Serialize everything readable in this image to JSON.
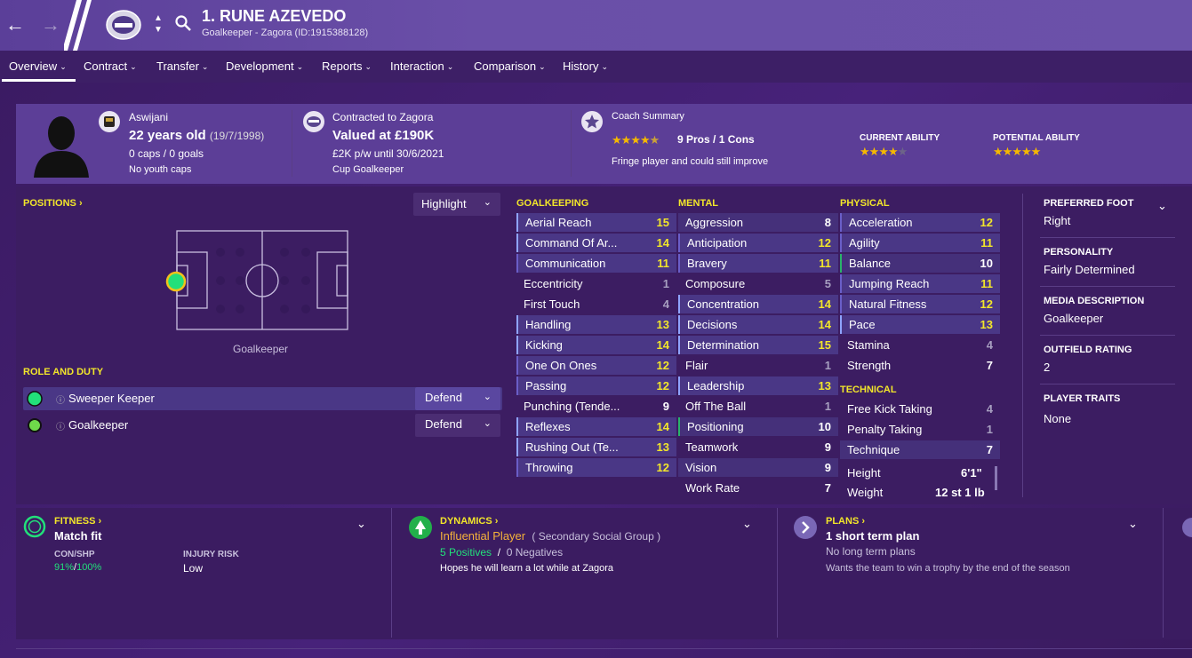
{
  "header": {
    "player_title": "1. RUNE AZEVEDO",
    "subtitle": "Goalkeeper - Zagora (ID:1915388128)"
  },
  "nav": {
    "tabs": [
      "Overview",
      "Contract",
      "Transfer",
      "Development",
      "Reports",
      "Interaction",
      "Comparison",
      "History"
    ]
  },
  "profile": {
    "nationality": "Aswijani",
    "age_label": "22 years old",
    "dob": "(19/7/1998)",
    "caps": "0 caps / 0 goals",
    "youth_caps": "No youth caps",
    "contracted": "Contracted to Zagora",
    "valued": "Valued at £190K",
    "wage": "£2K p/w until 30/6/2021",
    "role_status": "Cup Goalkeeper",
    "coach_summary_title": "Coach Summary",
    "pros_cons": "9 Pros / 1 Cons",
    "coach_note": "Fringe player and could still improve",
    "current_ability_label": "CURRENT ABILITY",
    "potential_ability_label": "POTENTIAL ABILITY",
    "coach_stars": 4.5,
    "current_stars": 4,
    "potential_stars": 5
  },
  "positions": {
    "title": "POSITIONS",
    "highlight": "Highlight",
    "position_label": "Goalkeeper",
    "role_duty_title": "ROLE AND DUTY",
    "roles": [
      {
        "name": "Sweeper Keeper",
        "duty": "Defend"
      },
      {
        "name": "Goalkeeper",
        "duty": "Defend"
      }
    ]
  },
  "attributes": {
    "goalkeeping_title": "GOALKEEPING",
    "mental_title": "MENTAL",
    "physical_title": "PHYSICAL",
    "technical_title": "TECHNICAL",
    "goalkeeping": [
      {
        "name": "Aerial Reach",
        "value": "15"
      },
      {
        "name": "Command Of Ar...",
        "value": "14"
      },
      {
        "name": "Communication",
        "value": "11"
      },
      {
        "name": "Eccentricity",
        "value": "1"
      },
      {
        "name": "First Touch",
        "value": "4"
      },
      {
        "name": "Handling",
        "value": "13"
      },
      {
        "name": "Kicking",
        "value": "14"
      },
      {
        "name": "One On Ones",
        "value": "12"
      },
      {
        "name": "Passing",
        "value": "12"
      },
      {
        "name": "Punching (Tende...",
        "value": "9"
      },
      {
        "name": "Reflexes",
        "value": "14"
      },
      {
        "name": "Rushing Out (Te...",
        "value": "13"
      },
      {
        "name": "Throwing",
        "value": "12"
      }
    ],
    "mental": [
      {
        "name": "Aggression",
        "value": "8"
      },
      {
        "name": "Anticipation",
        "value": "12"
      },
      {
        "name": "Bravery",
        "value": "11"
      },
      {
        "name": "Composure",
        "value": "5"
      },
      {
        "name": "Concentration",
        "value": "14"
      },
      {
        "name": "Decisions",
        "value": "14"
      },
      {
        "name": "Determination",
        "value": "15"
      },
      {
        "name": "Flair",
        "value": "1"
      },
      {
        "name": "Leadership",
        "value": "13"
      },
      {
        "name": "Off The Ball",
        "value": "1"
      },
      {
        "name": "Positioning",
        "value": "10"
      },
      {
        "name": "Teamwork",
        "value": "9"
      },
      {
        "name": "Vision",
        "value": "9"
      },
      {
        "name": "Work Rate",
        "value": "7"
      }
    ],
    "physical": [
      {
        "name": "Acceleration",
        "value": "12"
      },
      {
        "name": "Agility",
        "value": "11"
      },
      {
        "name": "Balance",
        "value": "10"
      },
      {
        "name": "Jumping Reach",
        "value": "11"
      },
      {
        "name": "Natural Fitness",
        "value": "12"
      },
      {
        "name": "Pace",
        "value": "13"
      },
      {
        "name": "Stamina",
        "value": "4"
      },
      {
        "name": "Strength",
        "value": "7"
      }
    ],
    "technical": [
      {
        "name": "Free Kick Taking",
        "value": "4"
      },
      {
        "name": "Penalty Taking",
        "value": "1"
      },
      {
        "name": "Technique",
        "value": "7"
      }
    ],
    "height_label": "Height",
    "height": "6'1\"",
    "weight_label": "Weight",
    "weight": "12 st 1 lb"
  },
  "info": {
    "preferred_foot_label": "PREFERRED FOOT",
    "preferred_foot": "Right",
    "personality_label": "PERSONALITY",
    "personality": "Fairly Determined",
    "media_label": "MEDIA DESCRIPTION",
    "media": "Goalkeeper",
    "outfield_label": "OUTFIELD RATING",
    "outfield": "2",
    "traits_label": "PLAYER TRAITS",
    "traits": "None"
  },
  "fitness": {
    "title": "FITNESS",
    "status": "Match fit",
    "con_label": "CON/SHP",
    "con": "91%",
    "shp": "100%",
    "injury_label": "INJURY RISK",
    "injury": "Low"
  },
  "dynamics": {
    "title": "DYNAMICS",
    "influence": "Influential Player",
    "group": "( Secondary Social Group )",
    "positives": "5 Positives",
    "negatives": "0 Negatives",
    "note": "Hopes he will learn a lot while at Zagora"
  },
  "plans": {
    "title": "PLANS",
    "short": "1 short term plan",
    "long": "No long term plans",
    "note": "Wants the team to win a trophy by the end of the season"
  },
  "colors": {
    "accent_yellow": "#f2e62a",
    "highlight_green": "#22e07a",
    "header_purple": "#6a4fa8"
  }
}
